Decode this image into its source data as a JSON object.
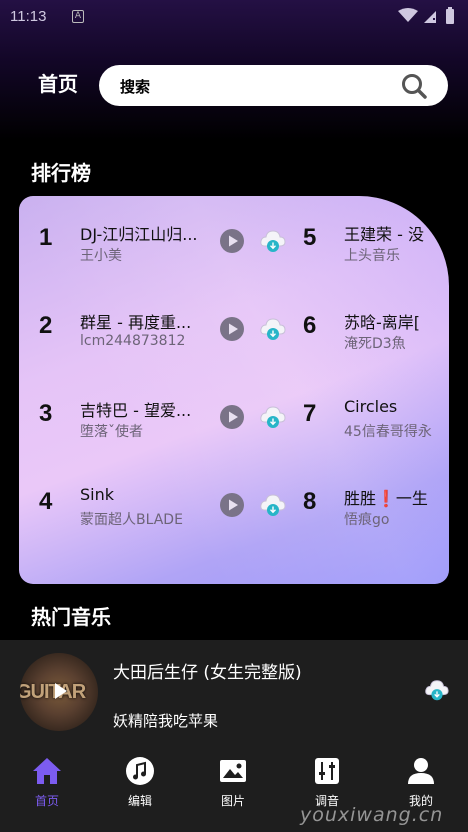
{
  "status_bar": {
    "time": "11:13",
    "notification_icon": "A"
  },
  "header": {
    "title": "首页",
    "search_text": "搜索"
  },
  "ranking": {
    "title": "排行榜",
    "items": [
      {
        "rank": "1",
        "title": "DJ-江归江山归...",
        "artist": "王小美"
      },
      {
        "rank": "2",
        "title": "群星 - 再度重...",
        "artist": "lcm244873812"
      },
      {
        "rank": "3",
        "title": "吉特巴 - 望爱...",
        "artist": "堕落ˇ使者"
      },
      {
        "rank": "4",
        "title": "Sink",
        "artist": "蒙面超人BLADE"
      },
      {
        "rank": "5",
        "title": "王建荣 - 没",
        "artist": "上头音乐"
      },
      {
        "rank": "6",
        "title": "苏晗-离岸[",
        "artist": "淹死D3魚"
      },
      {
        "rank": "7",
        "title": "Circles",
        "artist": "45信春哥得永"
      },
      {
        "rank": "8",
        "title": "胜胜❗一生",
        "artist": "悟痕go"
      }
    ]
  },
  "hot": {
    "title": "热门音乐"
  },
  "player": {
    "title": "大田后生仔 (女生完整版)",
    "artist": "妖精陪我吃苹果",
    "album_text": "GUITAR"
  },
  "nav": {
    "items": [
      {
        "label": "首页",
        "icon": "home-icon",
        "active": true
      },
      {
        "label": "编辑",
        "icon": "music-note-icon",
        "active": false
      },
      {
        "label": "图片",
        "icon": "image-icon",
        "active": false
      },
      {
        "label": "调音",
        "icon": "equalizer-icon",
        "active": false
      },
      {
        "label": "我的",
        "icon": "person-icon",
        "active": false
      }
    ]
  },
  "watermark": "youxiwang.cn",
  "colors": {
    "accent": "#7c5cf0",
    "card_pink": "#eac8f8",
    "card_violet": "#9c98fb",
    "panel": "#1e1e1e"
  }
}
